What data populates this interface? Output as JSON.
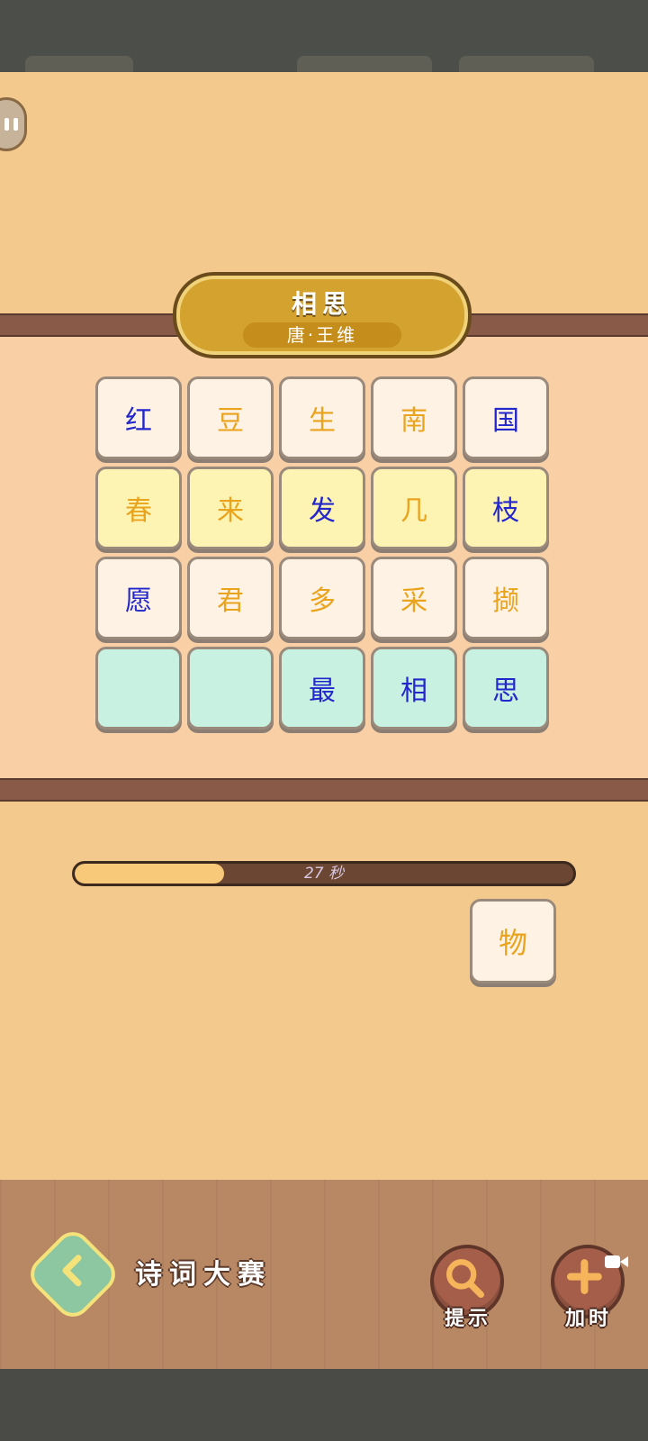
{
  "poem": {
    "title": "相思",
    "author": "唐·王维"
  },
  "grid": {
    "rows": [
      [
        {
          "char": "红",
          "color": "blue"
        },
        {
          "char": "豆",
          "color": "orange"
        },
        {
          "char": "生",
          "color": "orange"
        },
        {
          "char": "南",
          "color": "orange"
        },
        {
          "char": "国",
          "color": "blue"
        }
      ],
      [
        {
          "char": "春",
          "color": "orange"
        },
        {
          "char": "来",
          "color": "orange"
        },
        {
          "char": "发",
          "color": "blue"
        },
        {
          "char": "几",
          "color": "orange"
        },
        {
          "char": "枝",
          "color": "blue"
        }
      ],
      [
        {
          "char": "愿",
          "color": "blue"
        },
        {
          "char": "君",
          "color": "orange"
        },
        {
          "char": "多",
          "color": "orange"
        },
        {
          "char": "采",
          "color": "orange"
        },
        {
          "char": "撷",
          "color": "orange"
        }
      ],
      [
        {
          "char": "",
          "color": "blue"
        },
        {
          "char": "",
          "color": "blue"
        },
        {
          "char": "最",
          "color": "blue"
        },
        {
          "char": "相",
          "color": "blue"
        },
        {
          "char": "思",
          "color": "blue"
        }
      ]
    ]
  },
  "timer": {
    "text": "27 秒",
    "progress": 0.3
  },
  "spare_tile": {
    "char": "物"
  },
  "bottom_bar": {
    "game_title": "诗词大赛",
    "hint_label": "提示",
    "add_time_label": "加时"
  },
  "colors": {
    "blue": "#2226cc",
    "orange": "#eaa31d"
  },
  "icons": [
    "pause-icon",
    "back-arrow-icon",
    "search-icon",
    "plus-icon",
    "video-icon"
  ]
}
